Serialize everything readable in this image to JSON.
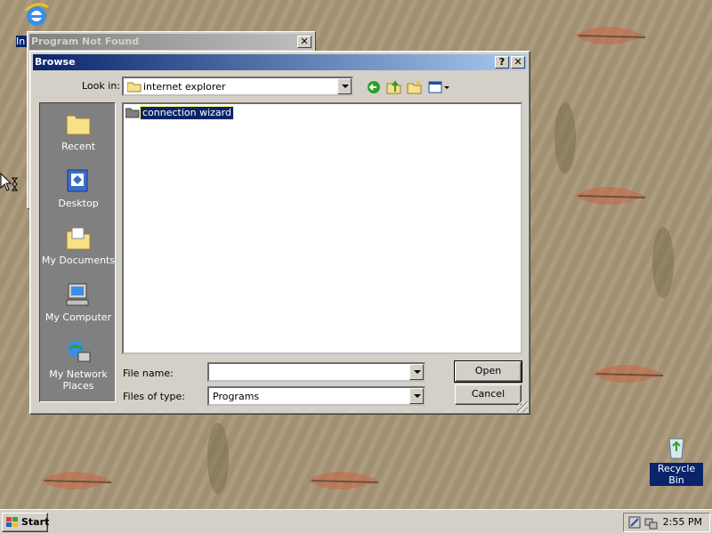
{
  "desktop": {
    "ie_icon_label": "In Ex",
    "recycle_label": "Recycle Bin"
  },
  "program_not_found": {
    "title": "Program Not Found"
  },
  "browse": {
    "title": "Browse",
    "help_btn": "?",
    "close_btn": "✕",
    "look_in_label": "Look in:",
    "look_in_value": "internet explorer",
    "places": [
      "Recent",
      "Desktop",
      "My Documents",
      "My Computer",
      "My Network Places"
    ],
    "files": [
      "connection wizard"
    ],
    "file_name_label": "File name:",
    "file_name_value": "",
    "files_of_type_label": "Files of type:",
    "files_of_type_value": "Programs",
    "open_label": "Open",
    "cancel_label": "Cancel"
  },
  "taskbar": {
    "start_label": "Start",
    "clock": "2:55 PM"
  },
  "colors": {
    "title_active": "#0a246a",
    "title_inactive": "#808080",
    "face": "#d4d0c8",
    "desktop": "#a89677"
  }
}
